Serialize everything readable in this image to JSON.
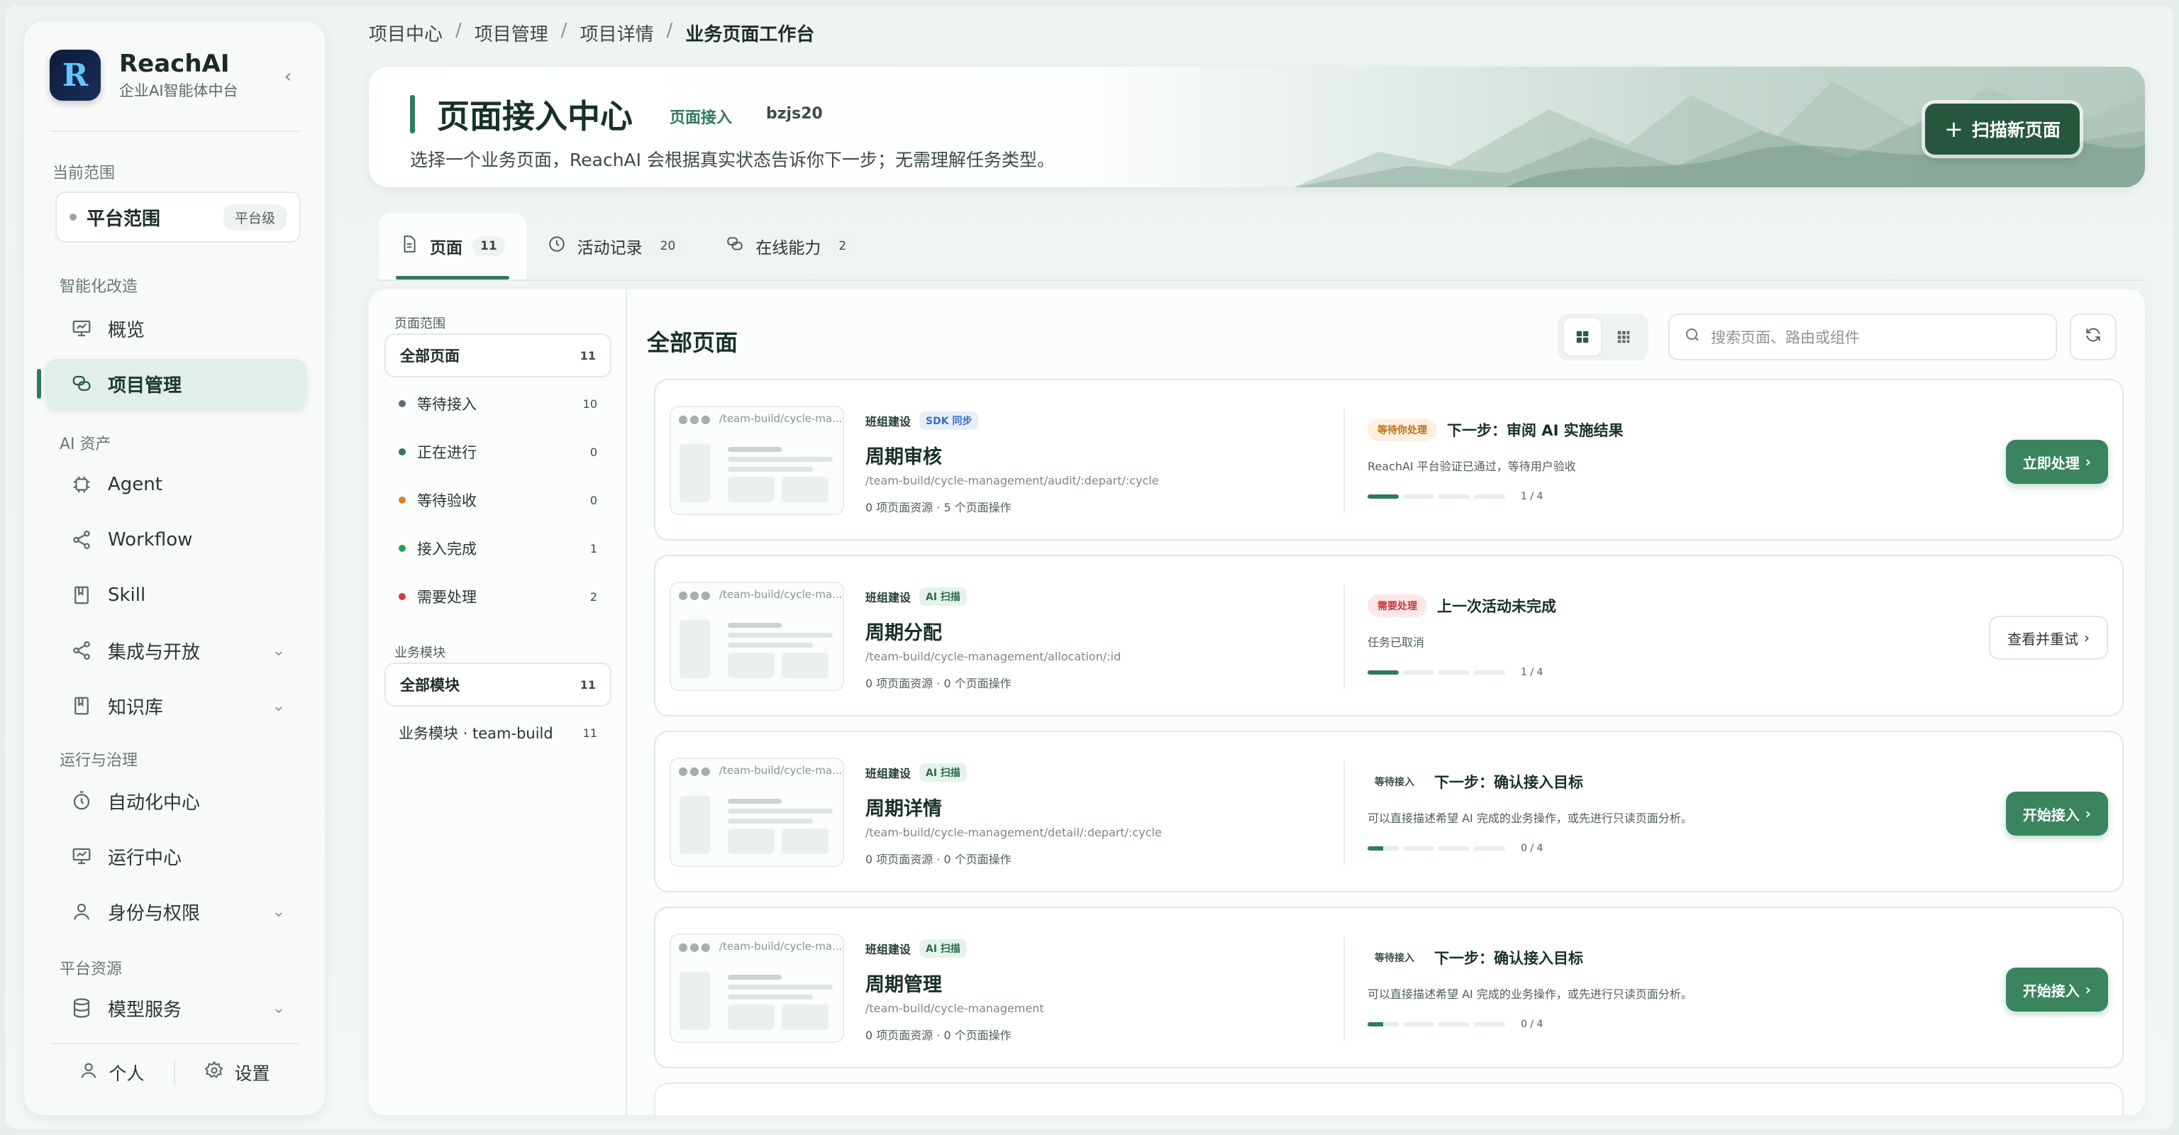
{
  "brand": {
    "name": "ReachAI",
    "subtitle": "企业AI智能体中台",
    "logo_letter": "R"
  },
  "sidebar": {
    "scope_label": "当前范围",
    "scope": {
      "name": "平台范围",
      "tag": "平台级"
    },
    "sections": [
      {
        "label": "智能化改造"
      },
      {
        "label": "AI 资产"
      },
      {
        "label": "运行与治理"
      },
      {
        "label": "平台资源"
      }
    ],
    "items": [
      {
        "label": "概览",
        "icon": "presentation-icon"
      },
      {
        "label": "项目管理",
        "icon": "chat-bubbles-icon",
        "active": true
      },
      {
        "label": "Agent",
        "icon": "chip-icon"
      },
      {
        "label": "Workflow",
        "icon": "share-nodes-icon"
      },
      {
        "label": "Skill",
        "icon": "book-icon"
      },
      {
        "label": "集成与开放",
        "icon": "share-nodes-icon",
        "expandable": true
      },
      {
        "label": "知识库",
        "icon": "book-icon",
        "expandable": true
      },
      {
        "label": "自动化中心",
        "icon": "timer-icon"
      },
      {
        "label": "运行中心",
        "icon": "presentation-icon"
      },
      {
        "label": "身份与权限",
        "icon": "user-icon",
        "expandable": true
      },
      {
        "label": "模型服务",
        "icon": "database-icon",
        "expandable": true
      }
    ],
    "footer": {
      "personal": "个人",
      "settings": "设置"
    }
  },
  "breadcrumb": {
    "items": [
      "项目中心",
      "项目管理",
      "项目详情"
    ],
    "current": "业务页面工作台",
    "separator": "/"
  },
  "header": {
    "title": "页面接入中心",
    "chip": "页面接入",
    "code": "bzjs20",
    "description": "选择一个业务页面，ReachAI 会根据真实状态告诉你下一步；无需理解任务类型。",
    "scan_button": "扫描新页面"
  },
  "tabs": [
    {
      "label": "页面",
      "count": "11",
      "icon": "document-icon"
    },
    {
      "label": "活动记录",
      "count": "20",
      "icon": "clock-icon"
    },
    {
      "label": "在线能力",
      "count": "2",
      "icon": "chat-bubbles-icon"
    }
  ],
  "filters": {
    "scope_label": "页面范围",
    "statuses": [
      {
        "label": "全部页面",
        "count": "11",
        "color": ""
      },
      {
        "label": "等待接入",
        "count": "10",
        "color": "#5c6b78"
      },
      {
        "label": "正在进行",
        "count": "0",
        "color": "#2f7a5c"
      },
      {
        "label": "等待验收",
        "count": "0",
        "color": "#d9822b"
      },
      {
        "label": "接入完成",
        "count": "1",
        "color": "#2f9a5c"
      },
      {
        "label": "需要处理",
        "count": "2",
        "color": "#d23b3b"
      }
    ],
    "module_label": "业务模块",
    "modules": [
      {
        "label": "全部模块",
        "count": "11"
      },
      {
        "label": "业务模块 · team-build",
        "count": "11"
      }
    ]
  },
  "list": {
    "title": "全部页面",
    "search_placeholder": "搜索页面、路由或组件"
  },
  "cards": [
    {
      "thumb_url": "/team-build/cycle-ma...",
      "module": "班组建设",
      "source": "SDK 同步",
      "source_kind": "sdk",
      "name": "周期审核",
      "route": "/team-build/cycle-management/audit/:depart/:cycle",
      "meta": "0 项页面资源 · 5 个页面操作",
      "badge": "等待你处理",
      "badge_kind": "wait",
      "next": "下一步：审阅 AI 实施结果",
      "hint": "ReachAI 平台验证已通过，等待用户验收",
      "progress_label": "1 / 4",
      "progress": 0.25,
      "action": "立即处理",
      "action_kind": "pri"
    },
    {
      "thumb_url": "/team-build/cycle-ma...",
      "module": "班组建设",
      "source": "AI 扫描",
      "source_kind": "ai",
      "name": "周期分配",
      "route": "/team-build/cycle-management/allocation/:id",
      "meta": "0 项页面资源 · 0 个页面操作",
      "badge": "需要处理",
      "badge_kind": "err",
      "next": "上一次活动未完成",
      "hint": "任务已取消",
      "progress_label": "1 / 4",
      "progress": 0.25,
      "action": "查看并重试",
      "action_kind": "sec"
    },
    {
      "thumb_url": "/team-build/cycle-ma...",
      "module": "班组建设",
      "source": "AI 扫描",
      "source_kind": "ai",
      "name": "周期详情",
      "route": "/team-build/cycle-management/detail/:depart/:cycle",
      "meta": "0 项页面资源 · 0 个页面操作",
      "badge": "等待接入",
      "badge_kind": "plain",
      "next": "下一步：确认接入目标",
      "hint": "可以直接描述希望 AI 完成的业务操作，或先进行只读页面分析。",
      "progress_label": "0 / 4",
      "progress": 0.125,
      "action": "开始接入",
      "action_kind": "pri"
    },
    {
      "thumb_url": "/team-build/cycle-ma...",
      "module": "班组建设",
      "source": "AI 扫描",
      "source_kind": "ai",
      "name": "周期管理",
      "route": "/team-build/cycle-management",
      "meta": "0 项页面资源 · 0 个页面操作",
      "badge": "等待接入",
      "badge_kind": "plain",
      "next": "下一步：确认接入目标",
      "hint": "可以直接描述希望 AI 完成的业务操作，或先进行只读页面分析。",
      "progress_label": "0 / 4",
      "progress": 0.125,
      "action": "开始接入",
      "action_kind": "pri"
    }
  ],
  "colors": {
    "accent": "#2f7a5c",
    "primary_button": "#3a8460",
    "scan_button": "#27563f",
    "warning": "#c06d13",
    "danger": "#c23b3b"
  }
}
